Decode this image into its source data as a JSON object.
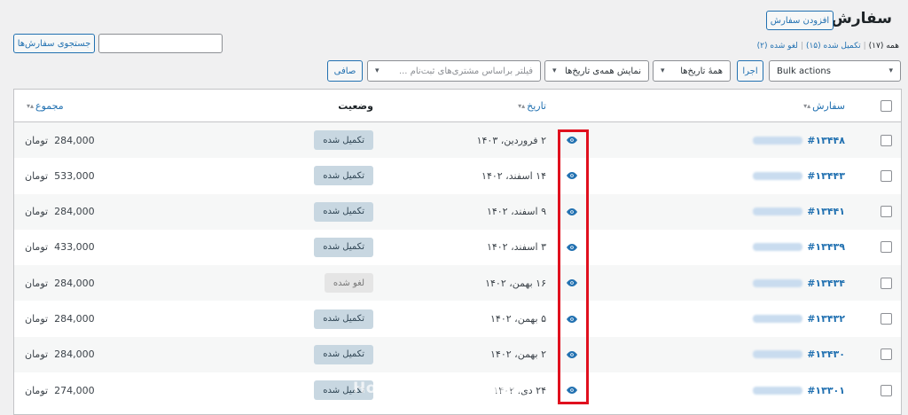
{
  "header": {
    "title": "سفارش‌ها",
    "add_button": "افزودن سفارش",
    "search_button": "جستجوی سفارش‌ها",
    "search_value": ""
  },
  "views": [
    {
      "label": "همه",
      "count": "(۱۷)"
    },
    {
      "label": "تکمیل شده",
      "count": "(۱۵)"
    },
    {
      "label": "لغو شده",
      "count": "(۲)"
    }
  ],
  "filters": {
    "bulk_actions": "Bulk actions",
    "apply": "اجرا",
    "dates": "همهٔ تاریخ‌ها",
    "months": "نمایش همه‌ی تاریخ‌ها",
    "customer_placeholder": "فیلتر براساس مشتری‌های ثبت‌نام ...",
    "filter_button": "صافی",
    "chevron_icon": "chevron-down-icon"
  },
  "columns": {
    "order": "سفارش",
    "date": "تاریخ",
    "status": "وضعیت",
    "total": "مجموع"
  },
  "currency": "تومان",
  "status_colors": {
    "completed": "#c8d7e1",
    "cancelled": "#e5e5e5"
  },
  "orders": [
    {
      "number": "#۱۳۴۴۸",
      "date": "۲ فروردین، ۱۴۰۳",
      "status": "تکمیل شده",
      "status_type": "completed",
      "total": "284,000"
    },
    {
      "number": "#۱۳۴۴۳",
      "date": "۱۴ اسفند، ۱۴۰۲",
      "status": "تکمیل شده",
      "status_type": "completed",
      "total": "533,000"
    },
    {
      "number": "#۱۳۴۴۱",
      "date": "۹ اسفند، ۱۴۰۲",
      "status": "تکمیل شده",
      "status_type": "completed",
      "total": "284,000"
    },
    {
      "number": "#۱۳۴۳۹",
      "date": "۳ اسفند، ۱۴۰۲",
      "status": "تکمیل شده",
      "status_type": "completed",
      "total": "433,000"
    },
    {
      "number": "#۱۳۴۳۴",
      "date": "۱۶ بهمن، ۱۴۰۲",
      "status": "لغو شده",
      "status_type": "cancelled",
      "total": "284,000"
    },
    {
      "number": "#۱۳۴۳۲",
      "date": "۵ بهمن، ۱۴۰۲",
      "status": "تکمیل شده",
      "status_type": "completed",
      "total": "284,000"
    },
    {
      "number": "#۱۳۴۳۰",
      "date": "۲ بهمن، ۱۴۰۲",
      "status": "تکمیل شده",
      "status_type": "completed",
      "total": "284,000"
    },
    {
      "number": "#۱۳۳۰۱",
      "date": "۲۴ دی، ۱۴۰۲",
      "status": "تکمیل شده",
      "status_type": "completed",
      "total": "274,000"
    }
  ],
  "watermark": "HosseinKazemi.net"
}
